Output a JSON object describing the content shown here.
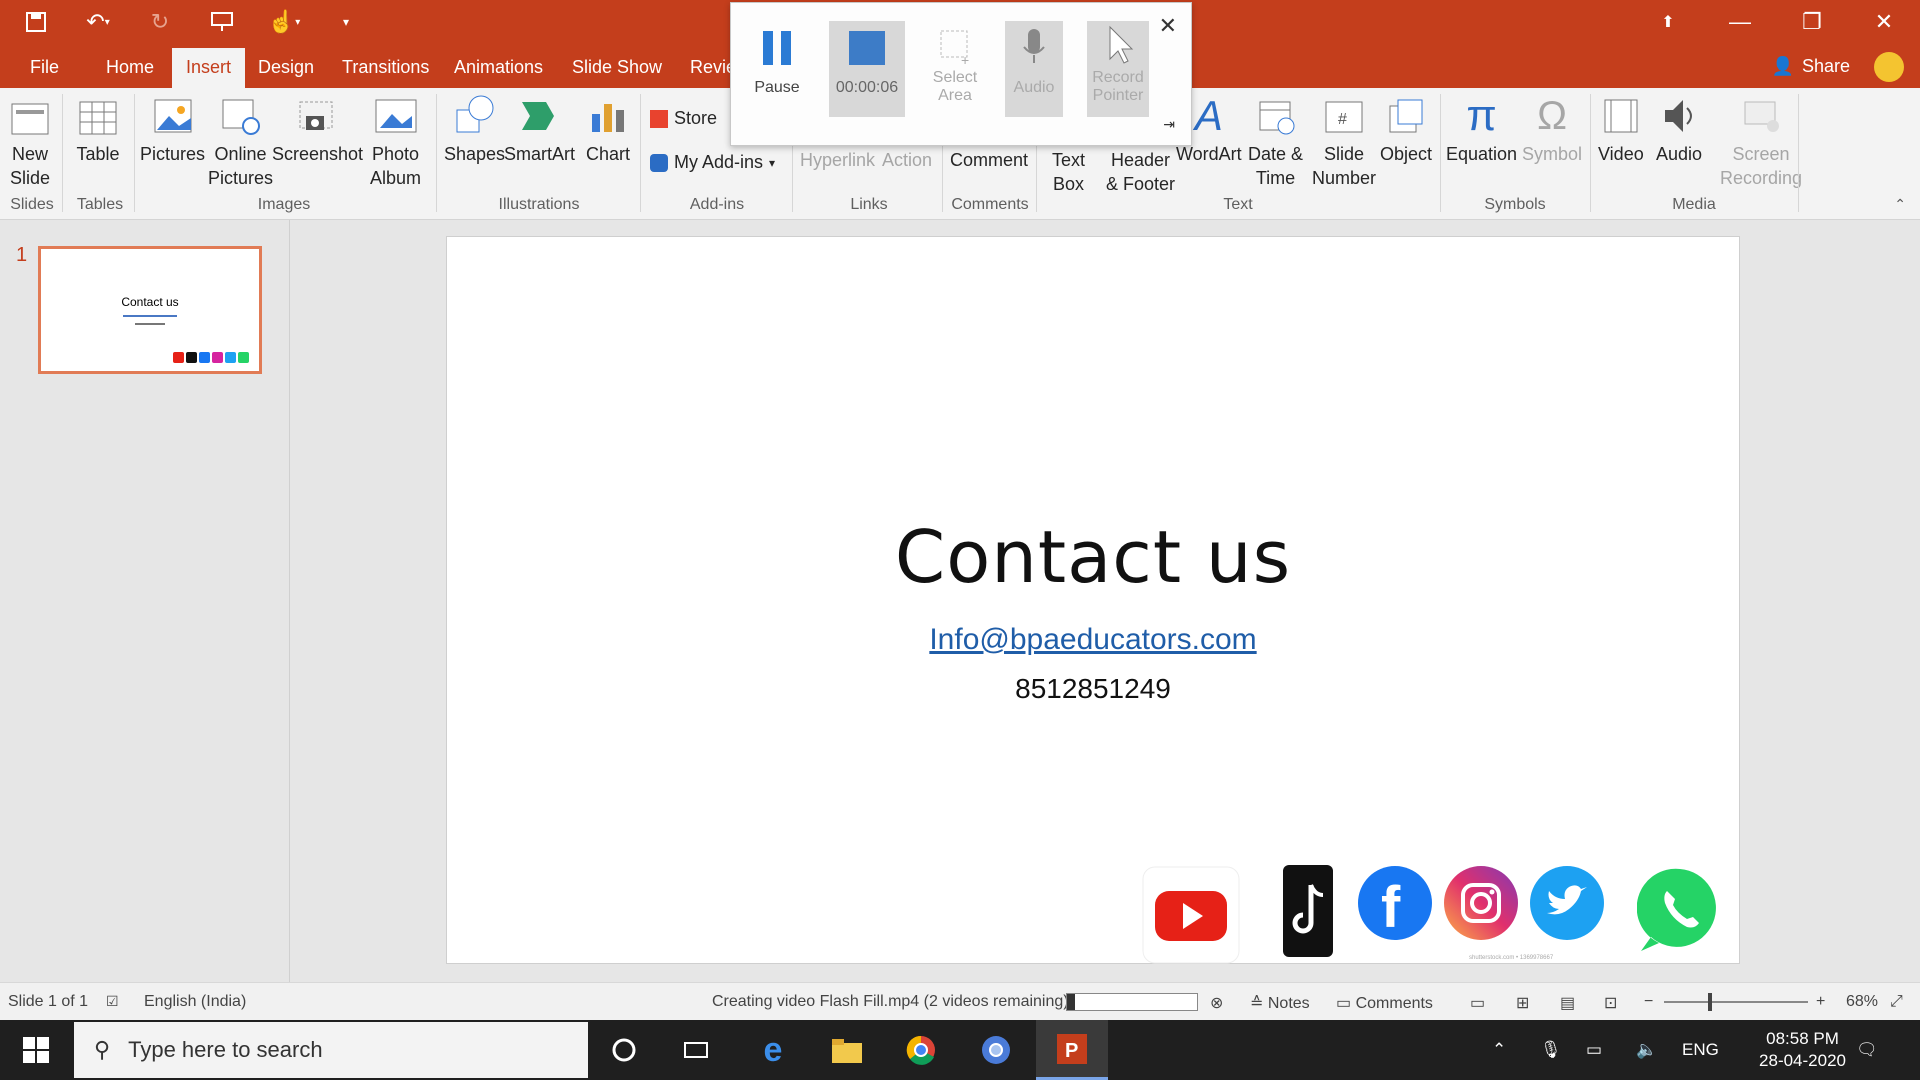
{
  "qat": {
    "save": "save-icon",
    "undo": "undo-icon",
    "redo": "redo-icon",
    "present": "present-icon",
    "touch": "touch-mode-icon",
    "customize": "customize-qat-icon"
  },
  "tabs": [
    {
      "label": "File"
    },
    {
      "label": "Home"
    },
    {
      "label": "Insert"
    },
    {
      "label": "Design"
    },
    {
      "label": "Transitions"
    },
    {
      "label": "Animations"
    },
    {
      "label": "Slide Show"
    },
    {
      "label": "Revie"
    }
  ],
  "share_label": "Share",
  "ribbon": {
    "slides": {
      "new_slide_1": "New",
      "new_slide_2": "Slide",
      "group": "Slides"
    },
    "tables": {
      "table": "Table",
      "group": "Tables"
    },
    "images": {
      "pictures": "Pictures",
      "online_1": "Online",
      "online_2": "Pictures",
      "screenshot": "Screenshot",
      "album_1": "Photo",
      "album_2": "Album",
      "group": "Images"
    },
    "illustrations": {
      "shapes": "Shapes",
      "smartart": "SmartArt",
      "chart": "Chart",
      "group": "Illustrations"
    },
    "addins": {
      "store": "Store",
      "my_addins": "My Add-ins",
      "group": "Add-ins"
    },
    "links": {
      "hyperlink": "Hyperlink",
      "action": "Action",
      "group": "Links"
    },
    "comments": {
      "comment": "Comment",
      "group": "Comments"
    },
    "text": {
      "textbox_1": "Text",
      "textbox_2": "Box",
      "header_1": "Header",
      "header_2": "& Footer",
      "wordart": "WordArt",
      "date_1": "Date &",
      "date_2": "Time",
      "slidenum_1": "Slide",
      "slidenum_2": "Number",
      "object": "Object",
      "group": "Text"
    },
    "symbols": {
      "equation": "Equation",
      "symbol": "Symbol",
      "group": "Symbols"
    },
    "media": {
      "video": "Video",
      "audio": "Audio",
      "screen_1": "Screen",
      "screen_2": "Recording",
      "group": "Media"
    }
  },
  "recording": {
    "pause": "Pause",
    "timer": "00:00:06",
    "select_1": "Select",
    "select_2": "Area",
    "audio": "Audio",
    "pointer_1": "Record",
    "pointer_2": "Pointer"
  },
  "thumbnail": {
    "number": "1",
    "title": "Contact us"
  },
  "slide": {
    "title": "Contact us",
    "email": "Info@bpaeducators.com",
    "phone": "8512851249",
    "stock_caption": "shutterstock.com • 1369978667",
    "social_icons": [
      "youtube-icon",
      "tiktok-icon",
      "facebook-icon",
      "instagram-icon",
      "twitter-icon",
      "whatsapp-icon"
    ]
  },
  "status": {
    "slide_count": "Slide 1 of 1",
    "language": "English (India)",
    "video_progress": "Creating video Flash Fill.mp4 (2 videos remaining)",
    "progress_fraction": 0.06,
    "notes": "Notes",
    "comments": "Comments",
    "zoom": "68%"
  },
  "taskbar": {
    "search_placeholder": "Type here to search",
    "lang": "ENG",
    "time": "08:58 PM",
    "date": "28-04-2020"
  },
  "colors": {
    "accent": "#c43e1c",
    "link": "#1f5da8"
  }
}
